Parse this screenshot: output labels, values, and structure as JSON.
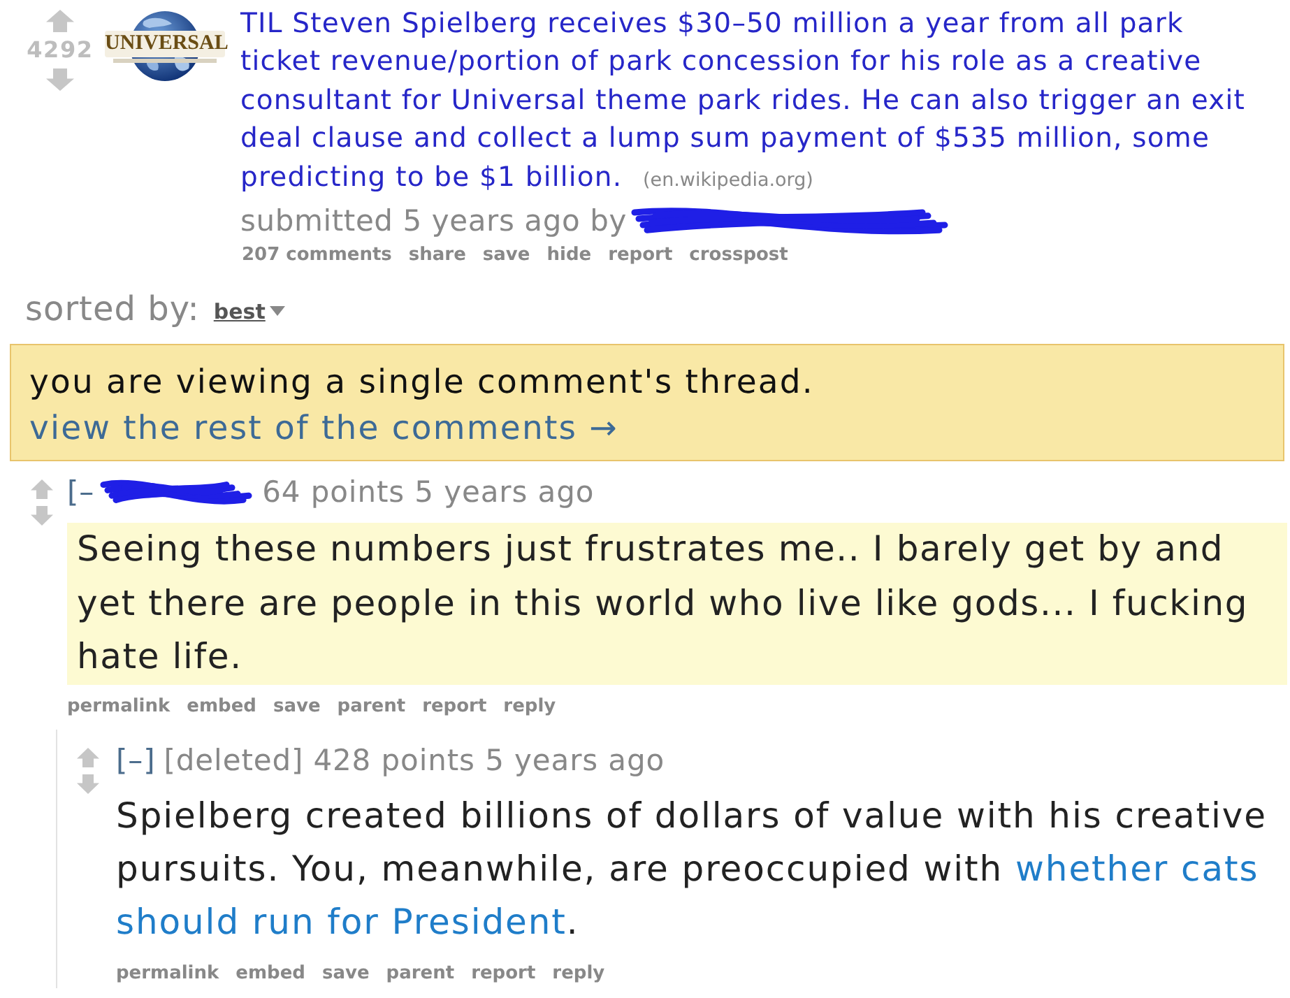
{
  "post": {
    "score": "4292",
    "thumbnail": {
      "logo_text": "UNIVERSAL"
    },
    "title": "TIL Steven Spielberg receives $30–50 million a year from all park ticket revenue/portion of park concession for his role as a creative consultant for Universal theme park rides. He can also trigger an exit deal clause and collect a lump sum payment of $535 million, some predicting to be $1 billion.",
    "domain": "(en.wikipedia.org)",
    "tagline": "submitted 5 years ago by",
    "author_redacted": true,
    "buttons": [
      "207 comments",
      "share",
      "save",
      "hide",
      "report",
      "crosspost"
    ]
  },
  "sort": {
    "label": "sorted by:",
    "value": "best"
  },
  "notice": {
    "message": "you are viewing a single comment's thread.",
    "link": "view the rest of the comments →"
  },
  "comments": [
    {
      "toggle": "[–",
      "author_redacted": true,
      "meta": "64 points 5 years ago",
      "highlighted": true,
      "body": [
        {
          "kind": "text",
          "text": "Seeing these numbers just frustrates me.. I barely get by and yet there are people in this world who live like gods... I fucking hate life."
        }
      ],
      "buttons": [
        "permalink",
        "embed",
        "save",
        "parent",
        "report",
        "reply"
      ],
      "children": [
        {
          "toggle": "[–]",
          "author": "[deleted]",
          "meta": "428 points 5 years ago",
          "highlighted": false,
          "body": [
            {
              "kind": "text",
              "text": "Spielberg created billions of dollars of value with his creative pursuits. You, meanwhile, are preoccupied with "
            },
            {
              "kind": "link",
              "text": "whether cats"
            },
            {
              "kind": "link",
              "text": "should run for President"
            },
            {
              "kind": "text",
              "text": "."
            }
          ],
          "buttons": [
            "permalink",
            "embed",
            "save",
            "parent",
            "report",
            "reply"
          ]
        }
      ]
    }
  ]
}
